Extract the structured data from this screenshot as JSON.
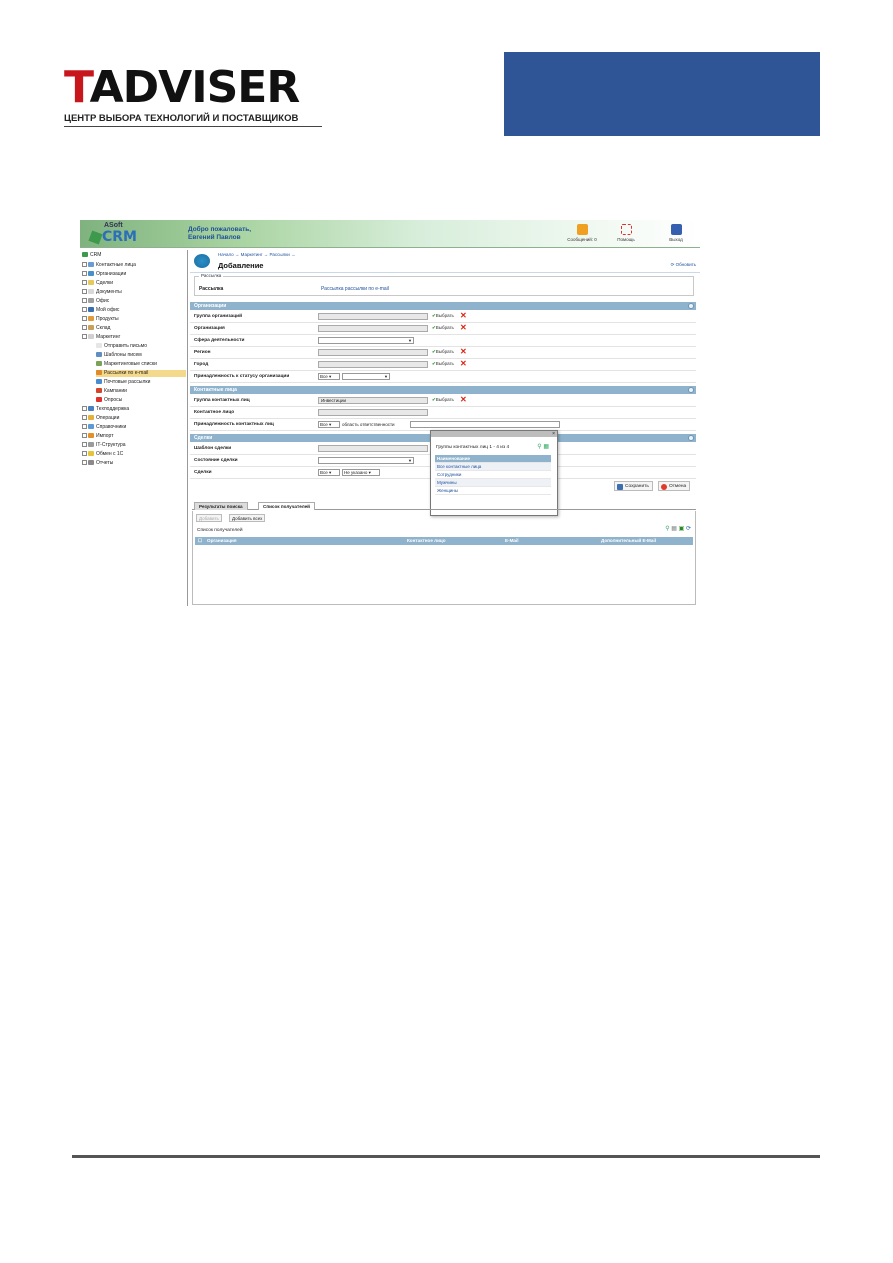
{
  "doc": {
    "logo_title_t": "T",
    "logo_title_rest": "ADVISER",
    "logo_subtitle": "ЦЕНТР ВЫБОРА ТЕХНОЛОГИЙ И ПОСТАВЩИКОВ",
    "banner_color": "#2f5597"
  },
  "app": {
    "brand_small": "ASoft",
    "brand_big": "CRM",
    "welcome_line1": "Добро пожаловать,",
    "welcome_line2": "Евгений Павлов",
    "top_actions": [
      {
        "label": "Сообщений: 0",
        "icon": "mail-icon"
      },
      {
        "label": "Помощь",
        "icon": "help-icon"
      },
      {
        "label": "Выход",
        "icon": "exit-icon"
      }
    ]
  },
  "sidebar": {
    "items": [
      {
        "label": "CRM",
        "indent": 0,
        "icon": "crm-icon"
      },
      {
        "label": "Контактные лица",
        "indent": 1,
        "icon": "contacts-icon"
      },
      {
        "label": "Организации",
        "indent": 1,
        "icon": "organizations-icon"
      },
      {
        "label": "Сделки",
        "indent": 1,
        "icon": "deals-icon"
      },
      {
        "label": "Документы",
        "indent": 1,
        "icon": "documents-icon"
      },
      {
        "label": "Офис",
        "indent": 1,
        "icon": "office-icon"
      },
      {
        "label": "Мой офис",
        "indent": 1,
        "icon": "my-office-icon"
      },
      {
        "label": "Продукты",
        "indent": 1,
        "icon": "products-icon"
      },
      {
        "label": "Склад",
        "indent": 1,
        "icon": "warehouse-icon"
      },
      {
        "label": "Маркетинг",
        "indent": 1,
        "icon": "marketing-icon"
      },
      {
        "label": "Отправить письмо",
        "indent": 2,
        "icon": "send-letter-icon"
      },
      {
        "label": "Шаблоны писем",
        "indent": 2,
        "icon": "templates-icon"
      },
      {
        "label": "Маркетинговые списки",
        "indent": 2,
        "icon": "lists-icon"
      },
      {
        "label": "Рассылки по e-mail",
        "indent": 2,
        "icon": "mailing-icon",
        "selected": true
      },
      {
        "label": "Почтовые рассылки",
        "indent": 2,
        "icon": "postal-icon"
      },
      {
        "label": "Кампании",
        "indent": 2,
        "icon": "campaigns-icon"
      },
      {
        "label": "Опросы",
        "indent": 2,
        "icon": "polls-icon"
      },
      {
        "label": "Техподдержка",
        "indent": 1,
        "icon": "support-icon"
      },
      {
        "label": "Операции",
        "indent": 1,
        "icon": "operations-icon"
      },
      {
        "label": "Справочники",
        "indent": 1,
        "icon": "directories-icon"
      },
      {
        "label": "Импорт",
        "indent": 1,
        "icon": "import-icon"
      },
      {
        "label": "IT-Структура",
        "indent": 1,
        "icon": "it-structure-icon"
      },
      {
        "label": "Обмен с 1С",
        "indent": 1,
        "icon": "exchange-icon"
      },
      {
        "label": "Отчеты",
        "indent": 1,
        "icon": "reports-icon"
      }
    ]
  },
  "main": {
    "breadcrumb": "Начало → Маркетинг → Рассылки →",
    "title": "Добавление",
    "refresh_label": "Обновить",
    "fieldset_legend": "Рассылка",
    "mailing_label": "Рассылка",
    "mailing_value": "Рассылка рассылки по e-mail",
    "sections": {
      "org": "Организации",
      "contacts": "Контактные лица",
      "deals": "Сделки"
    },
    "org_rows": {
      "group": "Группа организаций",
      "org": "Организация",
      "sphere": "Сфера деятельности",
      "region": "Регион",
      "city": "Город",
      "status": "Принадлежность к статусу организации"
    },
    "contact_rows": {
      "group": "Группа контактных лиц",
      "group_value": "Инвестиции",
      "contact": "Контактное лицо",
      "status": "Принадлежность контактных лиц",
      "responsibility": "область ответственности"
    },
    "deal_rows": {
      "template": "Шаблон сделки",
      "state": "Состояние сделки",
      "deals": "Сделки",
      "not_closed": "Не указано"
    },
    "pick_label": "Выбрать",
    "all_option": "Все",
    "save_label": "Сохранить",
    "cancel_label": "Отмена"
  },
  "popup": {
    "title": "Группы контактных лиц 1 - 4 из 4",
    "close": "×",
    "items": [
      "Наименование",
      "Все контактные лица",
      "Сотрудники",
      "Мужчины",
      "Женщины"
    ]
  },
  "bottom": {
    "tab_results": "Результаты поиска",
    "tab_recipients": "Список получателей",
    "add_button": "Добавить",
    "add_all_button": "Добавить всех",
    "recipients_label": "Список получателей",
    "columns": [
      "Организация",
      "Контактное лицо",
      "E-Mail",
      "Дополнительный E-Mail"
    ]
  }
}
